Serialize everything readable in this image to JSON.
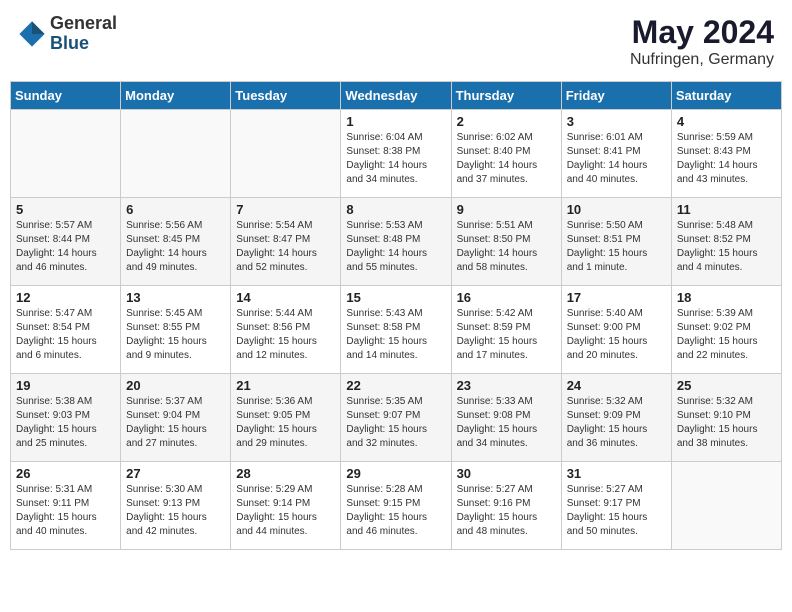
{
  "header": {
    "logo_general": "General",
    "logo_blue": "Blue",
    "month_title": "May 2024",
    "location": "Nufringen, Germany"
  },
  "days_of_week": [
    "Sunday",
    "Monday",
    "Tuesday",
    "Wednesday",
    "Thursday",
    "Friday",
    "Saturday"
  ],
  "weeks": [
    [
      {
        "day": "",
        "sunrise": "",
        "sunset": "",
        "daylight": ""
      },
      {
        "day": "",
        "sunrise": "",
        "sunset": "",
        "daylight": ""
      },
      {
        "day": "",
        "sunrise": "",
        "sunset": "",
        "daylight": ""
      },
      {
        "day": "1",
        "sunrise": "Sunrise: 6:04 AM",
        "sunset": "Sunset: 8:38 PM",
        "daylight": "Daylight: 14 hours and 34 minutes."
      },
      {
        "day": "2",
        "sunrise": "Sunrise: 6:02 AM",
        "sunset": "Sunset: 8:40 PM",
        "daylight": "Daylight: 14 hours and 37 minutes."
      },
      {
        "day": "3",
        "sunrise": "Sunrise: 6:01 AM",
        "sunset": "Sunset: 8:41 PM",
        "daylight": "Daylight: 14 hours and 40 minutes."
      },
      {
        "day": "4",
        "sunrise": "Sunrise: 5:59 AM",
        "sunset": "Sunset: 8:43 PM",
        "daylight": "Daylight: 14 hours and 43 minutes."
      }
    ],
    [
      {
        "day": "5",
        "sunrise": "Sunrise: 5:57 AM",
        "sunset": "Sunset: 8:44 PM",
        "daylight": "Daylight: 14 hours and 46 minutes."
      },
      {
        "day": "6",
        "sunrise": "Sunrise: 5:56 AM",
        "sunset": "Sunset: 8:45 PM",
        "daylight": "Daylight: 14 hours and 49 minutes."
      },
      {
        "day": "7",
        "sunrise": "Sunrise: 5:54 AM",
        "sunset": "Sunset: 8:47 PM",
        "daylight": "Daylight: 14 hours and 52 minutes."
      },
      {
        "day": "8",
        "sunrise": "Sunrise: 5:53 AM",
        "sunset": "Sunset: 8:48 PM",
        "daylight": "Daylight: 14 hours and 55 minutes."
      },
      {
        "day": "9",
        "sunrise": "Sunrise: 5:51 AM",
        "sunset": "Sunset: 8:50 PM",
        "daylight": "Daylight: 14 hours and 58 minutes."
      },
      {
        "day": "10",
        "sunrise": "Sunrise: 5:50 AM",
        "sunset": "Sunset: 8:51 PM",
        "daylight": "Daylight: 15 hours and 1 minute."
      },
      {
        "day": "11",
        "sunrise": "Sunrise: 5:48 AM",
        "sunset": "Sunset: 8:52 PM",
        "daylight": "Daylight: 15 hours and 4 minutes."
      }
    ],
    [
      {
        "day": "12",
        "sunrise": "Sunrise: 5:47 AM",
        "sunset": "Sunset: 8:54 PM",
        "daylight": "Daylight: 15 hours and 6 minutes."
      },
      {
        "day": "13",
        "sunrise": "Sunrise: 5:45 AM",
        "sunset": "Sunset: 8:55 PM",
        "daylight": "Daylight: 15 hours and 9 minutes."
      },
      {
        "day": "14",
        "sunrise": "Sunrise: 5:44 AM",
        "sunset": "Sunset: 8:56 PM",
        "daylight": "Daylight: 15 hours and 12 minutes."
      },
      {
        "day": "15",
        "sunrise": "Sunrise: 5:43 AM",
        "sunset": "Sunset: 8:58 PM",
        "daylight": "Daylight: 15 hours and 14 minutes."
      },
      {
        "day": "16",
        "sunrise": "Sunrise: 5:42 AM",
        "sunset": "Sunset: 8:59 PM",
        "daylight": "Daylight: 15 hours and 17 minutes."
      },
      {
        "day": "17",
        "sunrise": "Sunrise: 5:40 AM",
        "sunset": "Sunset: 9:00 PM",
        "daylight": "Daylight: 15 hours and 20 minutes."
      },
      {
        "day": "18",
        "sunrise": "Sunrise: 5:39 AM",
        "sunset": "Sunset: 9:02 PM",
        "daylight": "Daylight: 15 hours and 22 minutes."
      }
    ],
    [
      {
        "day": "19",
        "sunrise": "Sunrise: 5:38 AM",
        "sunset": "Sunset: 9:03 PM",
        "daylight": "Daylight: 15 hours and 25 minutes."
      },
      {
        "day": "20",
        "sunrise": "Sunrise: 5:37 AM",
        "sunset": "Sunset: 9:04 PM",
        "daylight": "Daylight: 15 hours and 27 minutes."
      },
      {
        "day": "21",
        "sunrise": "Sunrise: 5:36 AM",
        "sunset": "Sunset: 9:05 PM",
        "daylight": "Daylight: 15 hours and 29 minutes."
      },
      {
        "day": "22",
        "sunrise": "Sunrise: 5:35 AM",
        "sunset": "Sunset: 9:07 PM",
        "daylight": "Daylight: 15 hours and 32 minutes."
      },
      {
        "day": "23",
        "sunrise": "Sunrise: 5:33 AM",
        "sunset": "Sunset: 9:08 PM",
        "daylight": "Daylight: 15 hours and 34 minutes."
      },
      {
        "day": "24",
        "sunrise": "Sunrise: 5:32 AM",
        "sunset": "Sunset: 9:09 PM",
        "daylight": "Daylight: 15 hours and 36 minutes."
      },
      {
        "day": "25",
        "sunrise": "Sunrise: 5:32 AM",
        "sunset": "Sunset: 9:10 PM",
        "daylight": "Daylight: 15 hours and 38 minutes."
      }
    ],
    [
      {
        "day": "26",
        "sunrise": "Sunrise: 5:31 AM",
        "sunset": "Sunset: 9:11 PM",
        "daylight": "Daylight: 15 hours and 40 minutes."
      },
      {
        "day": "27",
        "sunrise": "Sunrise: 5:30 AM",
        "sunset": "Sunset: 9:13 PM",
        "daylight": "Daylight: 15 hours and 42 minutes."
      },
      {
        "day": "28",
        "sunrise": "Sunrise: 5:29 AM",
        "sunset": "Sunset: 9:14 PM",
        "daylight": "Daylight: 15 hours and 44 minutes."
      },
      {
        "day": "29",
        "sunrise": "Sunrise: 5:28 AM",
        "sunset": "Sunset: 9:15 PM",
        "daylight": "Daylight: 15 hours and 46 minutes."
      },
      {
        "day": "30",
        "sunrise": "Sunrise: 5:27 AM",
        "sunset": "Sunset: 9:16 PM",
        "daylight": "Daylight: 15 hours and 48 minutes."
      },
      {
        "day": "31",
        "sunrise": "Sunrise: 5:27 AM",
        "sunset": "Sunset: 9:17 PM",
        "daylight": "Daylight: 15 hours and 50 minutes."
      },
      {
        "day": "",
        "sunrise": "",
        "sunset": "",
        "daylight": ""
      }
    ]
  ]
}
